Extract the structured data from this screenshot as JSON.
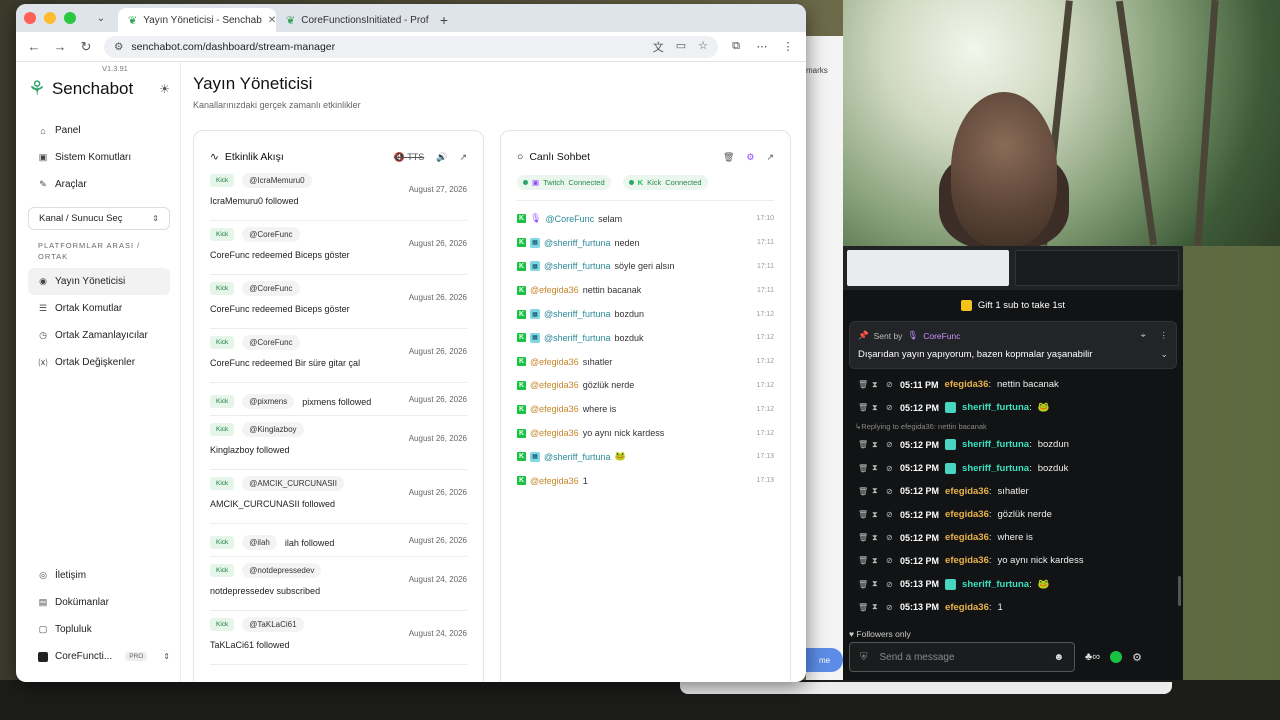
{
  "browser": {
    "tabs": [
      {
        "title": "Yayın Yöneticisi - Senchab",
        "active": true
      },
      {
        "title": "CoreFunctionsInitiated - Prof",
        "active": false
      }
    ],
    "url": "senchabot.com/dashboard/stream-manager"
  },
  "sidebar": {
    "brand": "Senchabot",
    "version": "V1.3.91",
    "items": [
      {
        "label": "Panel",
        "icon": "home-icon"
      },
      {
        "label": "Sistem Komutları",
        "icon": "terminal-icon"
      },
      {
        "label": "Araçlar",
        "icon": "wrench-icon"
      }
    ],
    "select_label": "Kanal / Sunucu Seç",
    "section_title": "PLATFORMLAR ARASI / ORTAK",
    "section_items": [
      {
        "label": "Yayın Yöneticisi",
        "icon": "broadcast-icon"
      },
      {
        "label": "Ortak Komutlar",
        "icon": "list-icon"
      },
      {
        "label": "Ortak Zamanlayıcılar",
        "icon": "clock-icon"
      },
      {
        "label": "Ortak Değişkenler",
        "icon": "variable-icon"
      }
    ],
    "bottom_items": [
      {
        "label": "İletişim",
        "icon": "contact-icon"
      },
      {
        "label": "Dokümanlar",
        "icon": "document-icon"
      },
      {
        "label": "Topluluk",
        "icon": "community-icon"
      }
    ],
    "account": {
      "name": "CoreFuncti...",
      "badge": "PRO"
    }
  },
  "main": {
    "title": "Yayın Yöneticisi",
    "subtitle": "Kanallarınızdaki gerçek zamanlı etkinlikler"
  },
  "activity": {
    "title": "Etkinlik Akışı",
    "tts_label": "TTS",
    "events": [
      {
        "platform": "Kick",
        "user": "@IcraMemuru0",
        "date": "August 27, 2026",
        "text": "IcraMemuru0 followed",
        "inline": false
      },
      {
        "platform": "Kick",
        "user": "@CoreFunc",
        "date": "August 26, 2026",
        "text": "CoreFunc redeemed Biceps göster",
        "inline": false
      },
      {
        "platform": "Kick",
        "user": "@CoreFunc",
        "date": "August 26, 2026",
        "text": "CoreFunc redeemed Biceps göster",
        "inline": false
      },
      {
        "platform": "Kick",
        "user": "@CoreFunc",
        "date": "August 26, 2026",
        "text": "CoreFunc redeemed Bir süre gitar çal",
        "inline": false
      },
      {
        "platform": "Kick",
        "user": "@pixmens",
        "date": "August 26, 2026",
        "text": "pixmens followed",
        "inline": true
      },
      {
        "platform": "Kick",
        "user": "@Kinglazboy",
        "date": "August 26, 2026",
        "text": "Kinglazboy followed",
        "inline": false
      },
      {
        "platform": "Kick",
        "user": "@AMCIK_CURCUNASII",
        "date": "August 26, 2026",
        "text": "AMCIK_CURCUNASII followed",
        "inline": false
      },
      {
        "platform": "Kick",
        "user": "@ilah",
        "date": "August 26, 2026",
        "text": "ilah followed",
        "inline": true
      },
      {
        "platform": "Kick",
        "user": "@notdepressedev",
        "date": "August 24, 2026",
        "text": "notdepressedev subscribed",
        "inline": false
      },
      {
        "platform": "Kick",
        "user": "@TaKLaCi61",
        "date": "August 24, 2026",
        "text": "TaKLaCi61 followed",
        "inline": false
      }
    ]
  },
  "chat": {
    "title": "Canlı Sohbet",
    "connections": [
      {
        "platform": "Twitch",
        "status": "Connected"
      },
      {
        "platform": "Kick",
        "status": "Connected"
      }
    ],
    "messages": [
      {
        "user": "@CoreFunc",
        "text": "selam",
        "time": "17:10",
        "style": "mod"
      },
      {
        "user": "@sheriff_furtuna",
        "text": "neden",
        "time": "17:11",
        "style": "badge"
      },
      {
        "user": "@sheriff_furtuna",
        "text": "söyle geri alsın",
        "time": "17:11",
        "style": "badge"
      },
      {
        "user": "@efegida36",
        "text": "nettin bacanak",
        "time": "17:11",
        "style": "plain"
      },
      {
        "user": "@sheriff_furtuna",
        "text": "bozdun",
        "time": "17:12",
        "style": "badge"
      },
      {
        "user": "@sheriff_furtuna",
        "text": "bozduk",
        "time": "17:12",
        "style": "badge"
      },
      {
        "user": "@efegida36",
        "text": "sıhatler",
        "time": "17:12",
        "style": "plain"
      },
      {
        "user": "@efegida36",
        "text": "gözlük nerde",
        "time": "17:12",
        "style": "plain"
      },
      {
        "user": "@efegida36",
        "text": "where is",
        "time": "17:12",
        "style": "plain"
      },
      {
        "user": "@efegida36",
        "text": "yo aynı nick kardess",
        "time": "17:12",
        "style": "plain"
      },
      {
        "user": "@sheriff_furtuna",
        "text": "🐸",
        "time": "17:13",
        "style": "badge"
      },
      {
        "user": "@efegida36",
        "text": "1",
        "time": "17:13",
        "style": "plain"
      }
    ]
  },
  "stream_chat": {
    "gift_text": "Gift 1 sub to take 1st",
    "pinned_sent_by": "Sent by",
    "pinned_user": "CoreFunc",
    "pinned_message": "Dışarıdan yayın yapıyorum, bazen kopmalar yaşanabilir",
    "messages": [
      {
        "time": "05:11 PM",
        "user": "efegida36",
        "text": "nettin bacanak",
        "color": "o"
      },
      {
        "time": "05:12 PM",
        "user": "sheriff_furtuna",
        "text": "🐸",
        "color": "c"
      },
      {
        "time": "05:12 PM",
        "user": "sheriff_furtuna",
        "text": "bozdun",
        "color": "c",
        "reply": "Replying to efegida36: nettin bacanak"
      },
      {
        "time": "05:12 PM",
        "user": "sheriff_furtuna",
        "text": "bozduk",
        "color": "c"
      },
      {
        "time": "05:12 PM",
        "user": "efegida36",
        "text": "sıhatler",
        "color": "o"
      },
      {
        "time": "05:12 PM",
        "user": "efegida36",
        "text": "gözlük nerde",
        "color": "o"
      },
      {
        "time": "05:12 PM",
        "user": "efegida36",
        "text": "where is",
        "color": "o"
      },
      {
        "time": "05:12 PM",
        "user": "efegida36",
        "text": "yo aynı nick kardess",
        "color": "o"
      },
      {
        "time": "05:13 PM",
        "user": "sheriff_furtuna",
        "text": "🐸",
        "color": "c"
      },
      {
        "time": "05:13 PM",
        "user": "efegida36",
        "text": "1",
        "color": "o"
      }
    ],
    "followers_only": "Followers only",
    "send_placeholder": "Send a message"
  },
  "background_window": {
    "partial_text": "marks",
    "button": "me"
  }
}
